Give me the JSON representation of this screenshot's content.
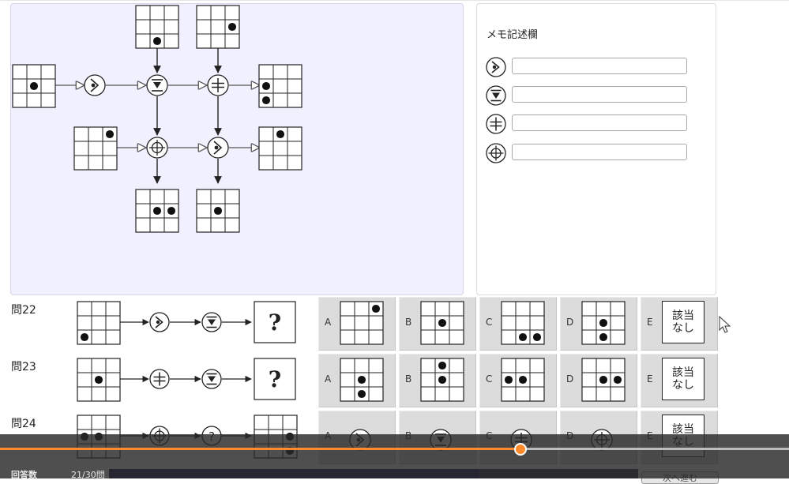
{
  "memo": {
    "title": "メモ記述欄",
    "rows": [
      {
        "symbol": "arrow-circle-icon",
        "value": ""
      },
      {
        "symbol": "hourglass-circle-icon",
        "value": ""
      },
      {
        "symbol": "divide-circle-icon",
        "value": ""
      },
      {
        "symbol": "crosshair-circle-icon",
        "value": ""
      }
    ]
  },
  "questions": [
    {
      "label": "問22",
      "input_grid": [
        [
          0,
          0,
          0
        ],
        [
          0,
          0,
          0
        ],
        [
          1,
          0,
          0
        ]
      ],
      "steps": [
        "arrow-circle-icon",
        "hourglass-circle-icon"
      ],
      "result": "?",
      "options": [
        {
          "letter": "A",
          "grid": [
            [
              0,
              0,
              1
            ],
            [
              0,
              0,
              0
            ],
            [
              0,
              0,
              0
            ]
          ]
        },
        {
          "letter": "B",
          "grid": [
            [
              0,
              0,
              0
            ],
            [
              0,
              1,
              0
            ],
            [
              0,
              0,
              0
            ]
          ]
        },
        {
          "letter": "C",
          "grid": [
            [
              0,
              0,
              0
            ],
            [
              0,
              0,
              0
            ],
            [
              0,
              1,
              1
            ]
          ]
        },
        {
          "letter": "D",
          "grid": [
            [
              0,
              0,
              0
            ],
            [
              0,
              1,
              0
            ],
            [
              0,
              1,
              0
            ]
          ]
        },
        {
          "letter": "E",
          "text": "該当\nなし"
        }
      ]
    },
    {
      "label": "問23",
      "input_grid": [
        [
          0,
          0,
          0
        ],
        [
          0,
          1,
          0
        ],
        [
          0,
          0,
          0
        ]
      ],
      "steps": [
        "divide-circle-icon",
        "hourglass-circle-icon"
      ],
      "result": "?",
      "options": [
        {
          "letter": "A",
          "grid": [
            [
              0,
              0,
              0
            ],
            [
              0,
              1,
              0
            ],
            [
              0,
              1,
              0
            ]
          ]
        },
        {
          "letter": "B",
          "grid": [
            [
              0,
              1,
              0
            ],
            [
              0,
              1,
              0
            ],
            [
              0,
              0,
              0
            ]
          ]
        },
        {
          "letter": "C",
          "grid": [
            [
              0,
              0,
              0
            ],
            [
              1,
              1,
              0
            ],
            [
              0,
              0,
              0
            ]
          ]
        },
        {
          "letter": "D",
          "grid": [
            [
              0,
              0,
              0
            ],
            [
              0,
              1,
              1
            ],
            [
              0,
              0,
              0
            ]
          ]
        },
        {
          "letter": "E",
          "text": "該当\nなし"
        }
      ]
    },
    {
      "label": "問24",
      "input_grid": [
        [
          0,
          0,
          0
        ],
        [
          1,
          1,
          0
        ],
        [
          0,
          0,
          0
        ]
      ],
      "steps": [
        "crosshair-circle-icon",
        "question-circle-icon"
      ],
      "result_grid": [
        [
          0,
          0,
          0
        ],
        [
          0,
          0,
          1
        ],
        [
          0,
          0,
          1
        ]
      ],
      "options": [
        {
          "letter": "A",
          "symbol": "arrow-circle-icon"
        },
        {
          "letter": "B",
          "symbol": "hourglass-circle-icon"
        },
        {
          "letter": "C",
          "symbol": "divide-circle-icon"
        },
        {
          "letter": "D",
          "symbol": "crosshair-circle-icon"
        },
        {
          "letter": "E",
          "text": "該当\nなし"
        }
      ]
    }
  ],
  "footer": {
    "answered_label": "回答数",
    "answered_count": "21/30問",
    "answered_fraction": 0.7,
    "next_label": "次へ進む"
  },
  "video_progress": 0.66,
  "colors": {
    "accent": "#ff8a2b",
    "panel": "#f0f0ff",
    "answer_bar": "#1f1f64"
  }
}
